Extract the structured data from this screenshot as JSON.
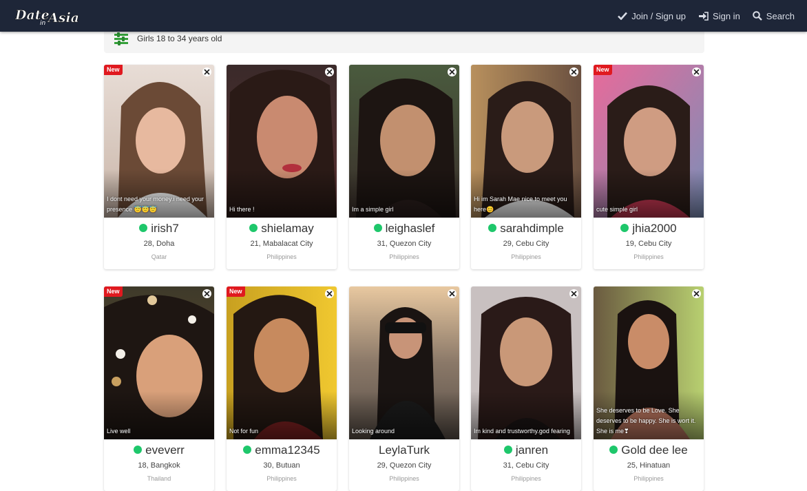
{
  "header": {
    "logo_line1": "Date",
    "logo_line2": "in",
    "logo_line3": "Asia",
    "nav": [
      {
        "label": "Join / Sign up",
        "icon": "check-icon"
      },
      {
        "label": "Sign in",
        "icon": "sign-in-icon"
      },
      {
        "label": "Search",
        "icon": "search-icon"
      }
    ]
  },
  "filter": {
    "label": "Girls 18 to 34 years old",
    "icon": "sliders-icon"
  },
  "colors": {
    "topbar": "#1e2638",
    "online": "#1ec76b",
    "new_badge": "#e0191f"
  },
  "cards": [
    {
      "name": "irish7",
      "age_city": "28, Doha",
      "country": "Qatar",
      "caption": "I dont need your money.i need your presence 😇😇😇",
      "new": "New",
      "online": true
    },
    {
      "name": "shielamay",
      "age_city": "21, Mabalacat City",
      "country": "Philippines",
      "caption": "Hi there !",
      "new": "",
      "online": true
    },
    {
      "name": "leighaslef",
      "age_city": "31, Quezon City",
      "country": "Philippines",
      "caption": "Im a simple girl",
      "new": "",
      "online": true
    },
    {
      "name": "sarahdimple",
      "age_city": "29, Cebu City",
      "country": "Philippines",
      "caption": "Hi im Sarah Mae nice to meet you here😊",
      "new": "",
      "online": true
    },
    {
      "name": "jhia2000",
      "age_city": "19, Cebu City",
      "country": "Philippines",
      "caption": "cute simple girl",
      "new": "New",
      "online": true
    },
    {
      "name": "eveverr",
      "age_city": "18, Bangkok",
      "country": "Thailand",
      "caption": "Live well",
      "new": "New",
      "online": true
    },
    {
      "name": "emma12345",
      "age_city": "30, Butuan",
      "country": "Philippines",
      "caption": "Not for fun",
      "new": "New",
      "online": true
    },
    {
      "name": "LeylaTurk",
      "age_city": "29, Quezon City",
      "country": "Philippines",
      "caption": "Looking around",
      "new": "",
      "online": false
    },
    {
      "name": "janren",
      "age_city": "31, Cebu City",
      "country": "Philippines",
      "caption": "Im kind and trustworthy.god fearing",
      "new": "",
      "online": true
    },
    {
      "name": "Gold dee lee",
      "age_city": "25, Hinatuan",
      "country": "Philippines",
      "caption": "She deserves to be Love. She deserves to be happy. She is wort it. She is me❣",
      "new": "",
      "online": true
    }
  ]
}
